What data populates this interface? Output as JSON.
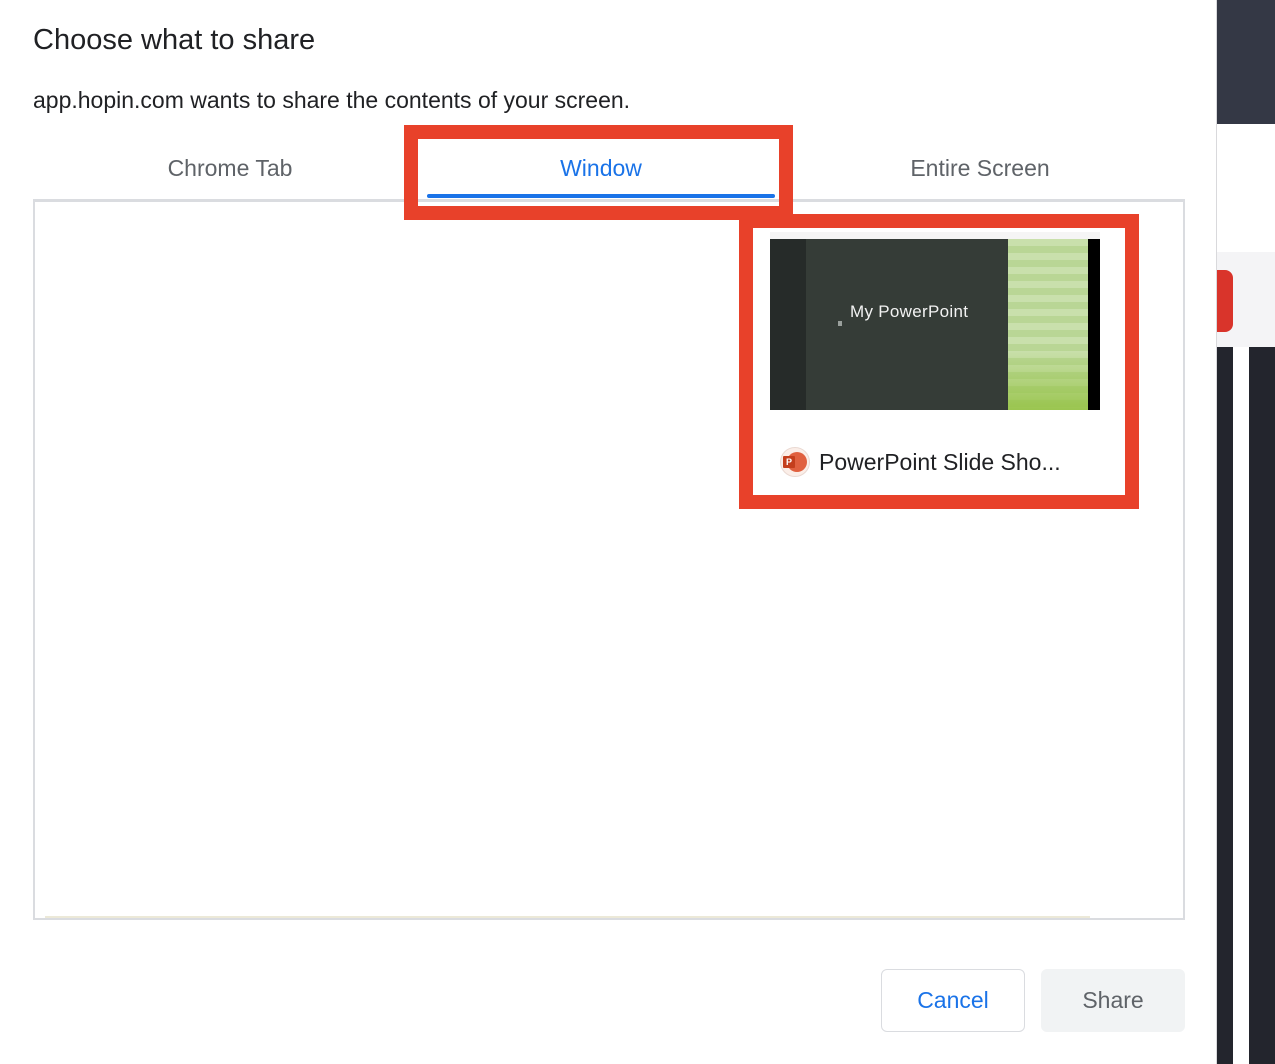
{
  "dialog": {
    "title": "Choose what to share",
    "subtitle": "app.hopin.com wants to share the contents of your screen."
  },
  "tabs": [
    {
      "label": "Chrome Tab",
      "selected": false
    },
    {
      "label": "Window",
      "selected": true
    },
    {
      "label": "Entire Screen",
      "selected": false
    }
  ],
  "sources": [
    {
      "name": "PowerPoint Slide Sho...",
      "thumbnail_text": "My PowerPoint",
      "icon": "powerpoint-icon",
      "icon_letter": "P"
    }
  ],
  "buttons": {
    "cancel": "Cancel",
    "share": "Share"
  },
  "colors": {
    "accent": "#1a73e8",
    "highlight": "#e8412a"
  }
}
